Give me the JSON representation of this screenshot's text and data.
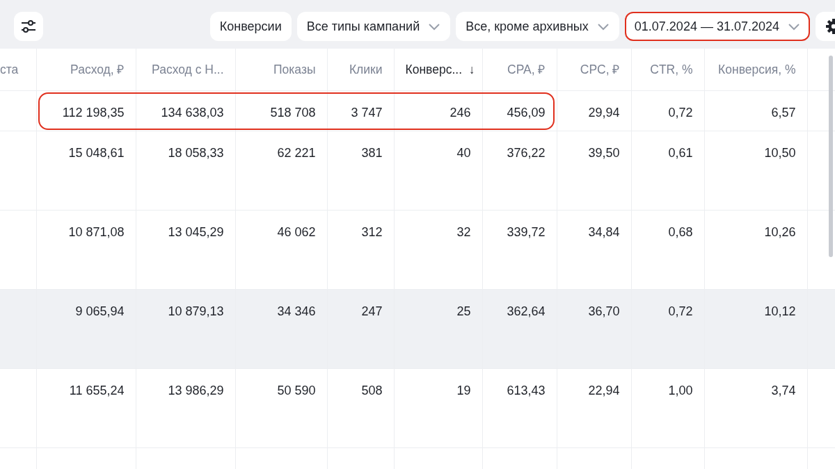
{
  "toolbar": {
    "buttons": [
      {
        "kind": "button",
        "label": "Конверсии",
        "highlighted": false
      },
      {
        "kind": "dropdown",
        "label": "Все типы кампаний",
        "highlighted": false
      },
      {
        "kind": "dropdown",
        "label": "Все, кроме архивных",
        "highlighted": false
      },
      {
        "kind": "dropdown",
        "label": "01.07.2024 — 31.07.2024",
        "highlighted": true
      }
    ]
  },
  "table": {
    "columns": [
      {
        "label": "ста",
        "sorted": false
      },
      {
        "label": "Расход, ₽",
        "sorted": false
      },
      {
        "label": "Расход с Н...",
        "sorted": false
      },
      {
        "label": "Показы",
        "sorted": false
      },
      {
        "label": "Клики",
        "sorted": false
      },
      {
        "label": "Конверс...",
        "sorted": true,
        "sort_icon": "↓"
      },
      {
        "label": "CPA, ₽",
        "sorted": false
      },
      {
        "label": "CPC, ₽",
        "sorted": false
      },
      {
        "label": "CTR, %",
        "sorted": false
      },
      {
        "label": "Конверсия, %",
        "sorted": false
      }
    ],
    "rows": [
      {
        "kind": "total",
        "hovered": false,
        "cells": [
          {
            "text": ""
          },
          {
            "text": "112 198,35",
            "highlighted": true
          },
          {
            "text": "134 638,03",
            "highlighted": true
          },
          {
            "text": "518 708",
            "highlighted": true
          },
          {
            "text": "3 747",
            "highlighted": true
          },
          {
            "text": "246",
            "highlighted": true
          },
          {
            "text": "456,09",
            "highlighted": true
          },
          {
            "text": "29,94",
            "highlighted": false
          },
          {
            "text": "0,72",
            "highlighted": false
          },
          {
            "text": "6,57",
            "highlighted": false
          }
        ]
      },
      {
        "kind": "data",
        "hovered": false,
        "cells": [
          {
            "text": ""
          },
          {
            "text": "15 048,61"
          },
          {
            "text": "18 058,33"
          },
          {
            "text": "62 221"
          },
          {
            "text": "381"
          },
          {
            "text": "40"
          },
          {
            "text": "376,22"
          },
          {
            "text": "39,50"
          },
          {
            "text": "0,61"
          },
          {
            "text": "10,50"
          }
        ]
      },
      {
        "kind": "data",
        "hovered": false,
        "cells": [
          {
            "text": ""
          },
          {
            "text": "10 871,08"
          },
          {
            "text": "13 045,29"
          },
          {
            "text": "46 062"
          },
          {
            "text": "312"
          },
          {
            "text": "32"
          },
          {
            "text": "339,72"
          },
          {
            "text": "34,84"
          },
          {
            "text": "0,68"
          },
          {
            "text": "10,26"
          }
        ]
      },
      {
        "kind": "data",
        "hovered": true,
        "cells": [
          {
            "text": ""
          },
          {
            "text": "9 065,94"
          },
          {
            "text": "10 879,13"
          },
          {
            "text": "34 346"
          },
          {
            "text": "247"
          },
          {
            "text": "25"
          },
          {
            "text": "362,64"
          },
          {
            "text": "36,70"
          },
          {
            "text": "0,72"
          },
          {
            "text": "10,12"
          }
        ]
      },
      {
        "kind": "data",
        "hovered": false,
        "cells": [
          {
            "text": ""
          },
          {
            "text": "11 655,24"
          },
          {
            "text": "13 986,29"
          },
          {
            "text": "50 590"
          },
          {
            "text": "508"
          },
          {
            "text": "19"
          },
          {
            "text": "613,43"
          },
          {
            "text": "22,94"
          },
          {
            "text": "1,00"
          },
          {
            "text": "3,74"
          }
        ]
      }
    ]
  }
}
